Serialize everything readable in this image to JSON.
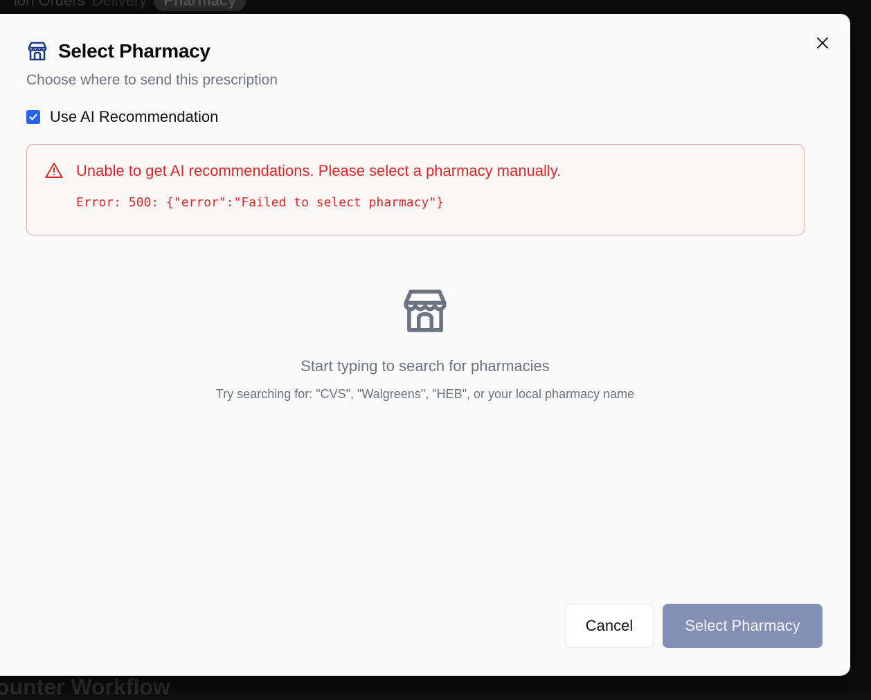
{
  "background": {
    "breadcrumb_left": "ion Orders",
    "breadcrumb_mid": "Delivery",
    "breadcrumb_pill": "Pharmacy",
    "bottom_heading": "ounter Workflow"
  },
  "dialog": {
    "title": "Select Pharmacy",
    "subtitle": "Choose where to send this prescription",
    "title_icon": "store-icon",
    "close_icon": "close-icon",
    "ai_checkbox": {
      "label": "Use AI Recommendation",
      "checked": true
    },
    "alert": {
      "icon": "warning-triangle-icon",
      "message": "Unable to get AI recommendations. Please select a pharmacy manually.",
      "detail": "Error: 500: {\"error\":\"Failed to select pharmacy\"}"
    },
    "empty_state": {
      "icon": "store-icon",
      "title": "Start typing to search for pharmacies",
      "hint": "Try searching for: \"CVS\", \"Walgreens\", \"HEB\", or your local pharmacy name"
    },
    "buttons": {
      "cancel": "Cancel",
      "confirm": "Select Pharmacy"
    }
  },
  "colors": {
    "error": "#dc2626",
    "checkbox": "#2563eb",
    "primary_disabled": "#8490b6",
    "title_icon": "#1e3a8a"
  }
}
